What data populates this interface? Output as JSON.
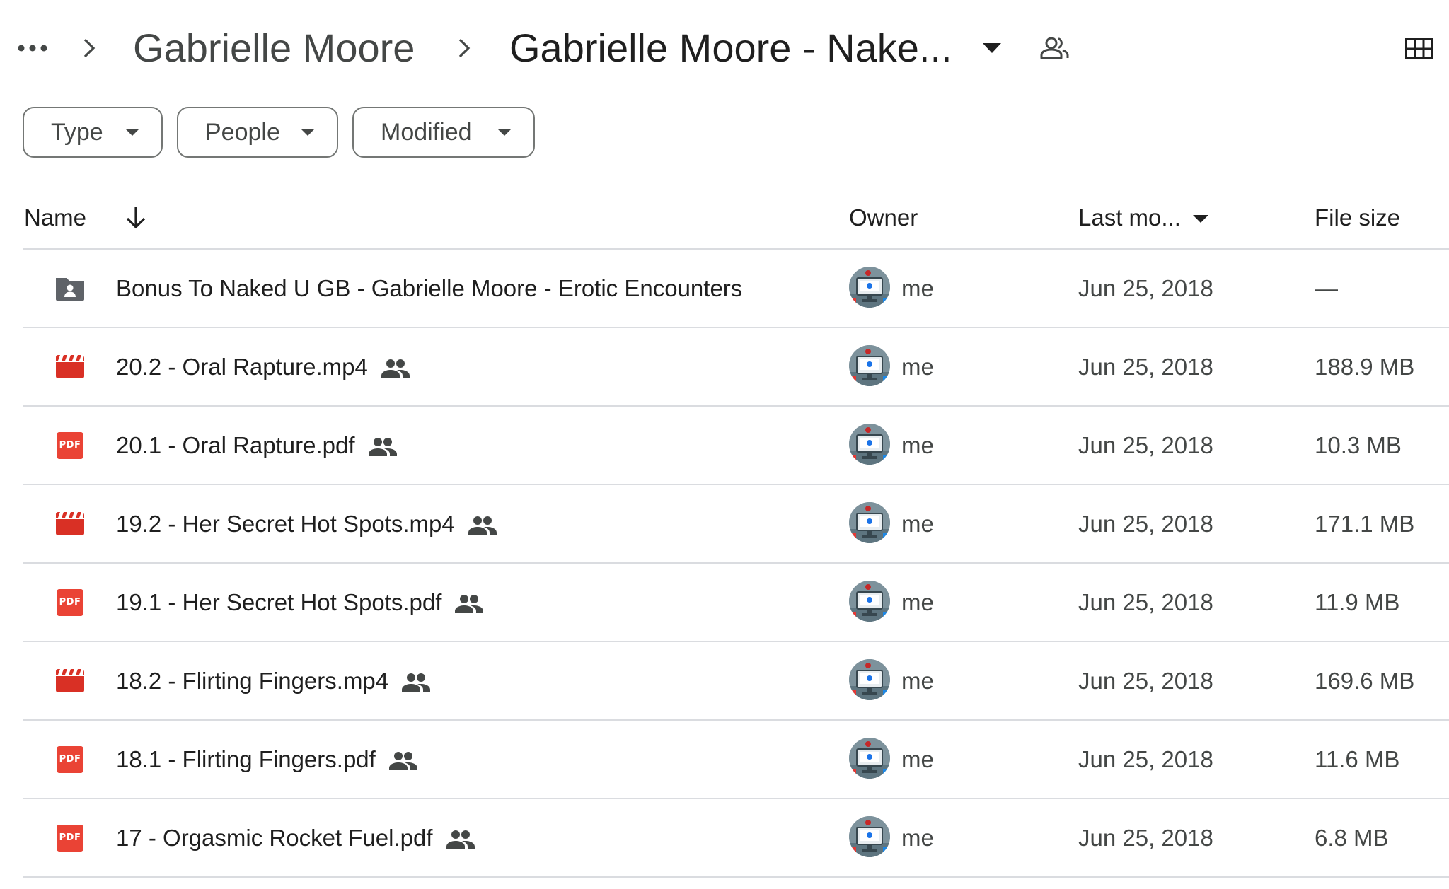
{
  "breadcrumb": {
    "more_icon": "more-horiz-icon",
    "parent": "Gabrielle Moore",
    "current": "Gabrielle Moore - Nake...",
    "dropdown_icon": "arrow-drop-down-icon",
    "share_icon": "people-outline-icon",
    "view_icon": "grid-view-icon"
  },
  "filters": [
    {
      "label": "Type"
    },
    {
      "label": "People"
    },
    {
      "label": "Modified"
    }
  ],
  "columns": {
    "name": "Name",
    "owner": "Owner",
    "last_modified": "Last mo...",
    "file_size": "File size"
  },
  "colors": {
    "text_primary": "#1f1f1f",
    "text_secondary": "#444746",
    "divider": "#dadce0",
    "video_red": "#d93025",
    "pdf_red": "#ea4335",
    "folder_grey": "#5f6368"
  },
  "rows": [
    {
      "type": "shared-folder",
      "icon": "shared-folder-icon",
      "name": "Bonus To Naked U GB - Gabrielle Moore - Erotic Encounters",
      "shared": false,
      "owner": "me",
      "modified": "Jun 25, 2018",
      "size": "—"
    },
    {
      "type": "video",
      "icon": "video-file-icon",
      "name": "20.2 - Oral Rapture.mp4",
      "shared": true,
      "owner": "me",
      "modified": "Jun 25, 2018",
      "size": "188.9 MB"
    },
    {
      "type": "pdf",
      "icon": "pdf-file-icon",
      "name": "20.1 - Oral Rapture.pdf",
      "shared": true,
      "owner": "me",
      "modified": "Jun 25, 2018",
      "size": "10.3 MB"
    },
    {
      "type": "video",
      "icon": "video-file-icon",
      "name": "19.2 - Her Secret Hot Spots.mp4",
      "shared": true,
      "owner": "me",
      "modified": "Jun 25, 2018",
      "size": "171.1 MB"
    },
    {
      "type": "pdf",
      "icon": "pdf-file-icon",
      "name": "19.1 - Her Secret Hot Spots.pdf",
      "shared": true,
      "owner": "me",
      "modified": "Jun 25, 2018",
      "size": "11.9 MB"
    },
    {
      "type": "video",
      "icon": "video-file-icon",
      "name": "18.2 - Flirting Fingers.mp4",
      "shared": true,
      "owner": "me",
      "modified": "Jun 25, 2018",
      "size": "169.6 MB"
    },
    {
      "type": "pdf",
      "icon": "pdf-file-icon",
      "name": "18.1 - Flirting Fingers.pdf",
      "shared": true,
      "owner": "me",
      "modified": "Jun 25, 2018",
      "size": "11.6 MB"
    },
    {
      "type": "pdf",
      "icon": "pdf-file-icon",
      "name": "17 - Orgasmic Rocket Fuel.pdf",
      "shared": true,
      "owner": "me",
      "modified": "Jun 25, 2018",
      "size": "6.8 MB"
    }
  ],
  "pdf_badge": "PDF"
}
